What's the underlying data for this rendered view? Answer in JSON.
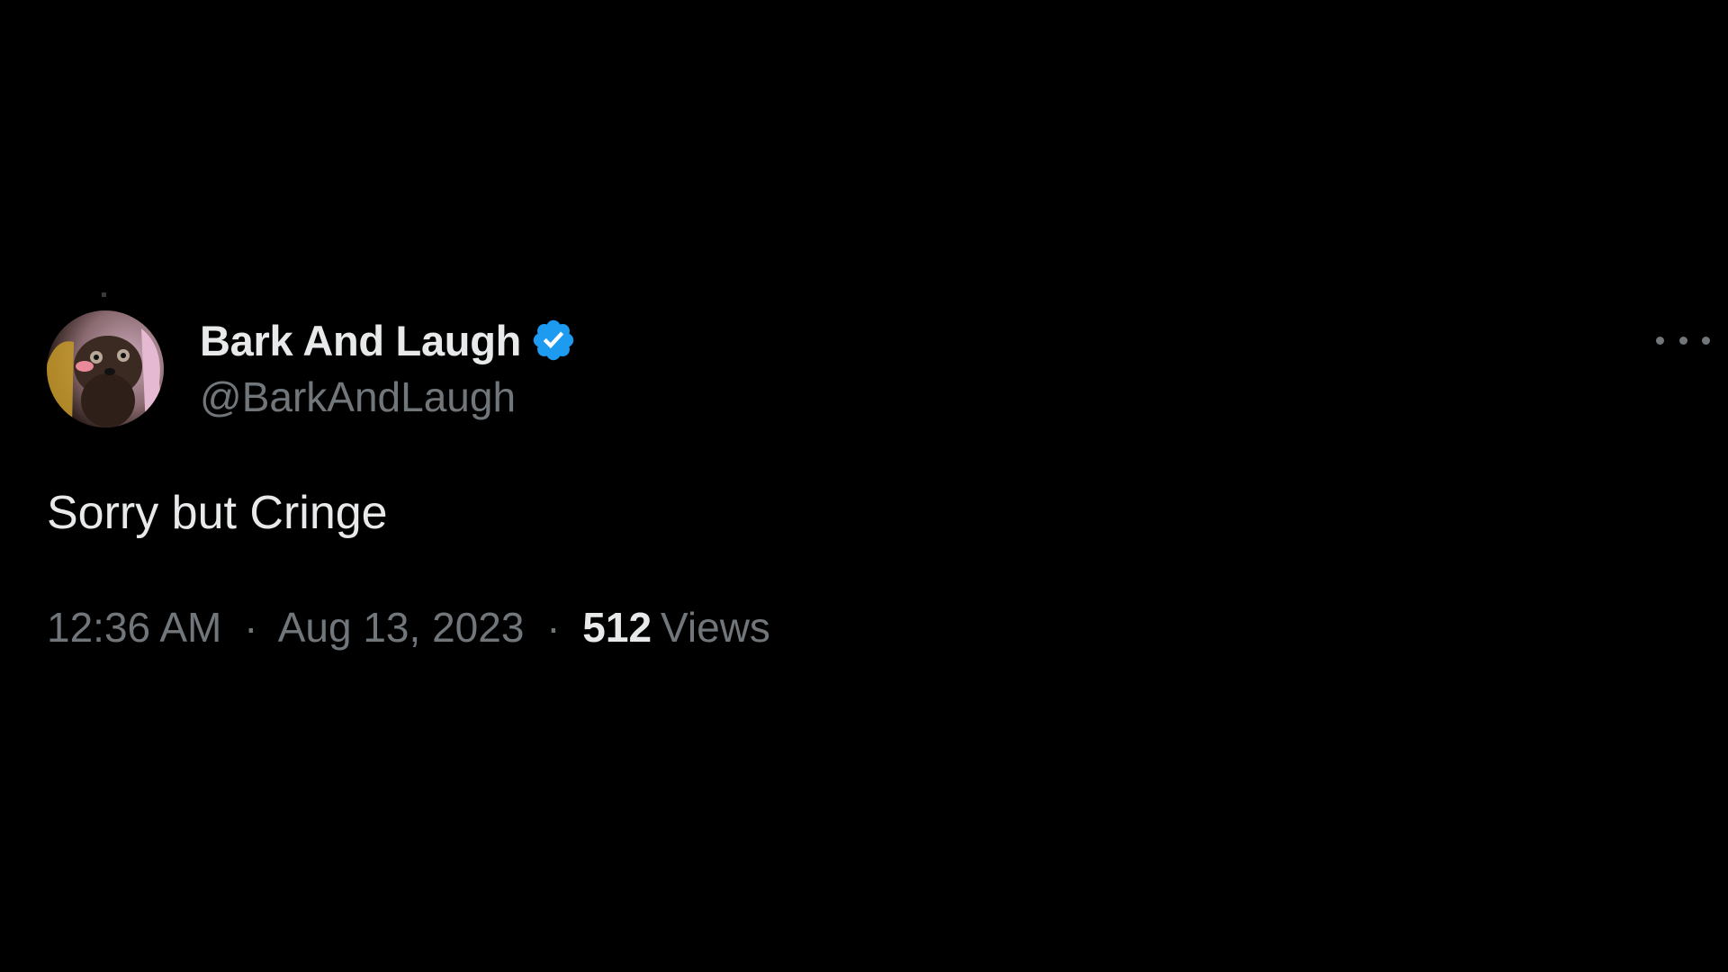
{
  "tweet": {
    "author": {
      "display_name": "Bark And Laugh",
      "handle": "@BarkAndLaugh",
      "verified": true,
      "avatar_icon": "dog-avatar"
    },
    "text": "Sorry but Cringe",
    "time": "12:36 AM",
    "date": "Aug 13, 2023",
    "separator": "·",
    "views_count": "512",
    "views_label": "Views",
    "more_icon": "more-horizontal-icon"
  },
  "colors": {
    "background": "#000000",
    "primary_text": "#e7e9ea",
    "secondary_text": "#71767b",
    "verified_badge": "#1d9bf0"
  }
}
